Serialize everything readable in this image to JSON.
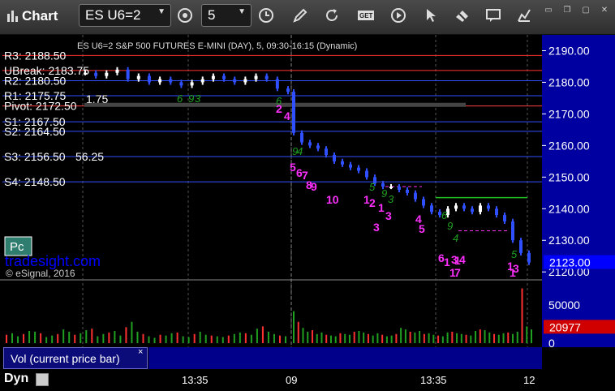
{
  "app": {
    "title": "Chart"
  },
  "toolbar": {
    "symbol": "ES U6=2",
    "interval": "5",
    "buttons": [
      "drawing-tool-icon",
      "refresh-icon",
      "get-icon",
      "play-icon",
      "cursor-icon",
      "comment-icon"
    ]
  },
  "window_controls": [
    "pin-icon",
    "restore-icon",
    "maximize-icon",
    "close-icon"
  ],
  "chart_data": {
    "type": "line",
    "instrument_caption": "ES U6=2 S&P 500 FUTURES E-MINI (DAY), 5, 09:30-16:15 (Dynamic)",
    "ylim": [
      2118,
      2195
    ],
    "y_ticks": [
      "2190.00",
      "2180.00",
      "2170.00",
      "2160.00",
      "2150.00",
      "2140.00",
      "2130.00",
      "2120.00"
    ],
    "x_ticks": [
      "13:35",
      "09",
      "13:35",
      "12"
    ],
    "levels": [
      {
        "label": "R3: 2188.50",
        "value": 2188.5,
        "color": "#ff3030"
      },
      {
        "label": "UBreak: 2183.75",
        "value": 2183.75,
        "color": "#ff3030"
      },
      {
        "label": "R2: 2180.50",
        "value": 2180.5,
        "color": "#3050ff"
      },
      {
        "label": "R1: 2175.75",
        "value": 2175.75,
        "color": "#3050ff"
      },
      {
        "label": "Pivot: 2172.50",
        "value": 2172.5,
        "color": "#ff4040"
      },
      {
        "label": "S1: 2167.50",
        "value": 2167.5,
        "color": "#3050ff"
      },
      {
        "label": "S2: 2164.50",
        "value": 2164.5,
        "color": "#3050ff"
      },
      {
        "label": "S3: 2156.50",
        "value": 2156.5,
        "color": "#3050ff"
      },
      {
        "label": "S4: 2148.50",
        "value": 2148.5,
        "color": "#3050ff"
      }
    ],
    "overlap_labels": [
      "1.75",
      "56.25"
    ],
    "price_path": [
      2183,
      2182,
      2183,
      2184,
      2181,
      2182,
      2180,
      2181,
      2180,
      2179,
      2180,
      2181,
      2182,
      2181,
      2180,
      2181,
      2182,
      2181,
      2178,
      2177,
      2164,
      2161,
      2160,
      2159,
      2157,
      2155,
      2154,
      2153,
      2152,
      2150,
      2148,
      2147,
      2147,
      2146,
      2145,
      2143,
      2141,
      2139,
      2138,
      2140,
      2141,
      2140,
      2139,
      2141,
      2140,
      2138,
      2136,
      2130,
      2126,
      2123
    ],
    "last_price": "2123.00",
    "setup_numbers_magenta": [
      "2",
      "4",
      "5",
      "6",
      "7",
      "8",
      "9",
      "10",
      "1",
      "2",
      "3",
      "1",
      "3",
      "4",
      "5",
      "6",
      "1",
      "3",
      "1",
      "4",
      "1",
      "7",
      "1",
      "3",
      "1"
    ],
    "setup_numbers_green": [
      "6",
      "9",
      "3",
      "6",
      "9",
      "4",
      "5",
      "9",
      "3",
      "6",
      "9",
      "4",
      "5"
    ],
    "volume": {
      "ticks": [
        "50000",
        "0"
      ],
      "ylim": [
        0,
        80000
      ],
      "current": "20977",
      "bars": [
        11000,
        13000,
        9000,
        12000,
        16000,
        15000,
        13000,
        8000,
        10000,
        12000,
        18000,
        15000,
        11000,
        13000,
        17000,
        19000,
        9000,
        12000,
        14000,
        16000,
        10000,
        21000,
        28000,
        15000,
        12000,
        9000,
        7000,
        11000,
        10000,
        13000,
        14000,
        9000,
        8000,
        12000,
        15000,
        11000,
        10000,
        9000,
        8000,
        10000,
        12000,
        14000,
        13000,
        11000,
        19000,
        22000,
        15000,
        12000,
        10000,
        9000,
        42000,
        28000,
        20000,
        15000,
        17000,
        12000,
        14000,
        11000,
        10000,
        9000,
        13000,
        12000,
        11000,
        15000,
        16000,
        14000,
        12000,
        10000,
        13000,
        11000,
        9000,
        10000,
        12000,
        20000,
        18000,
        15000,
        14000,
        16000,
        12000,
        13000,
        11000,
        10000,
        9000,
        14000,
        15000,
        13000,
        12000,
        11000,
        10000,
        16000,
        18000,
        17000,
        14000,
        12000,
        11000,
        13000,
        14000,
        12000,
        15000,
        72000,
        22000,
        18000
      ]
    },
    "watermark": "tradesight.com",
    "copyright": "© eSignal, 2016",
    "pc_label": "Pc"
  },
  "panel": {
    "vol_tab": "Vol (current price bar)",
    "close": "×",
    "dyn": "Dyn"
  }
}
